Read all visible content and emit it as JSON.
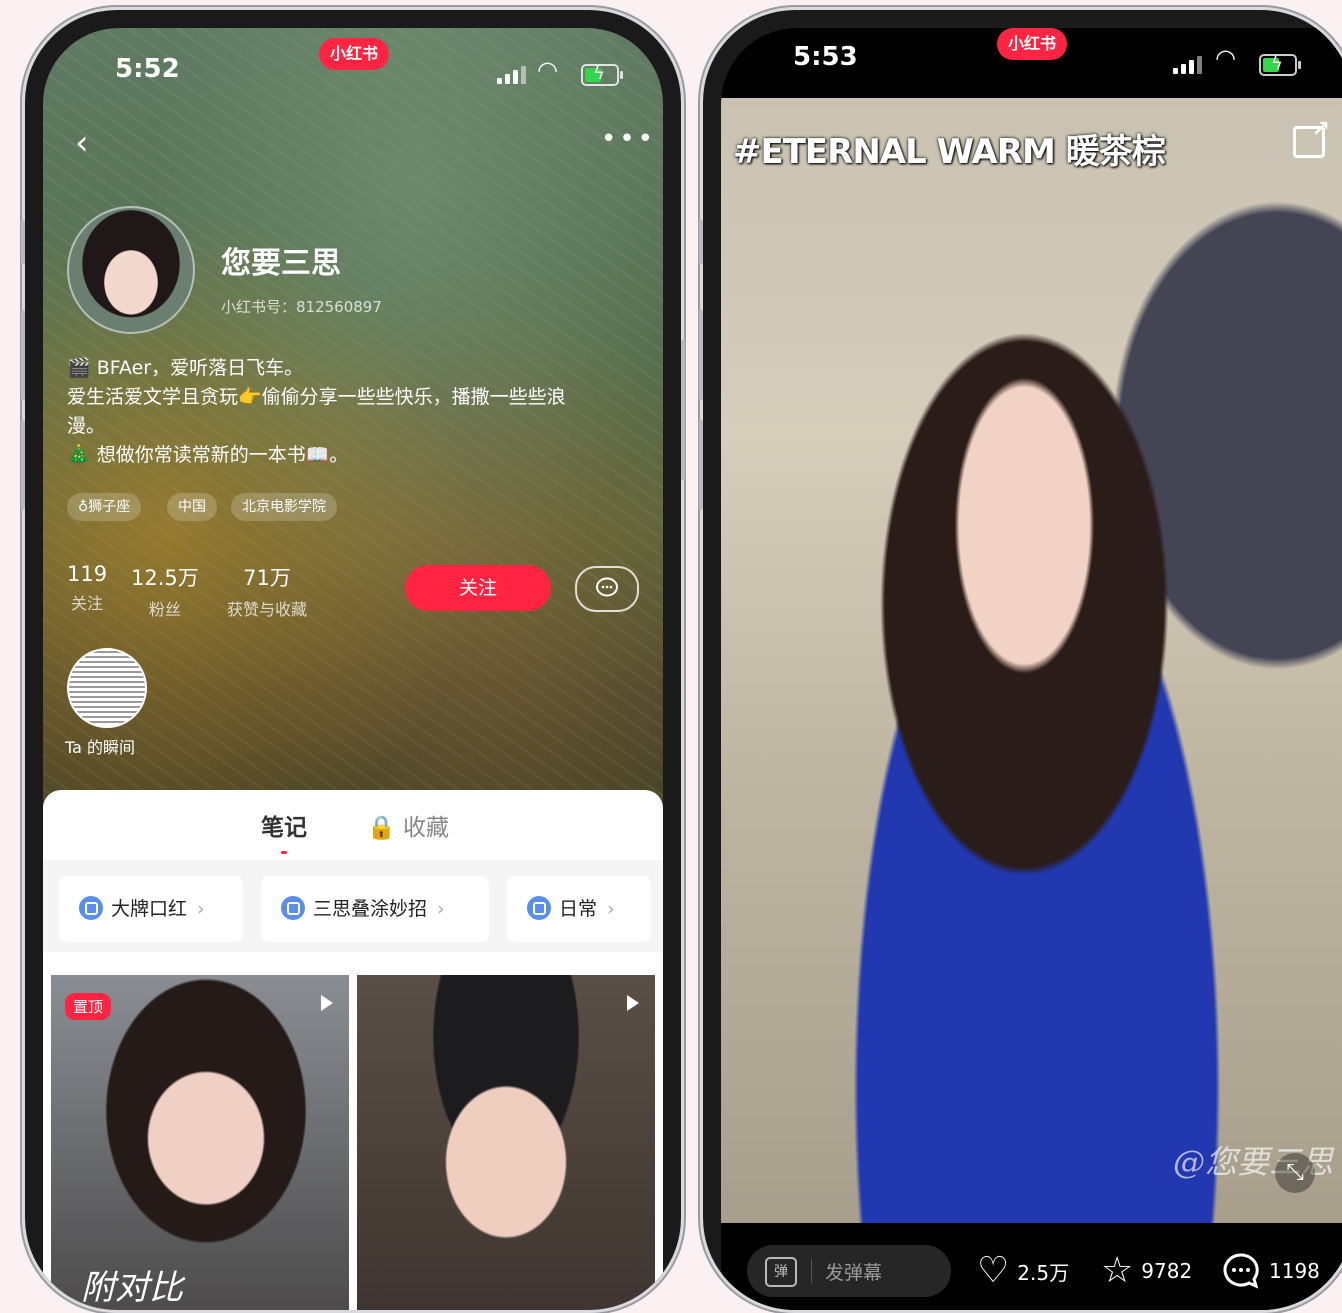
{
  "left": {
    "status": {
      "time": "5:52",
      "app_badge": "小红书"
    },
    "profile": {
      "name": "您要三思",
      "red_id": "小红书号：812560897",
      "bio_lines": [
        "🎬 BFAer，爱听落日飞车。",
        "爱生活爱文学且贪玩👉偷偷分享一些些快乐，播撒一些些浪",
        "漫。",
        "🎄 想做你常读常新的一本书📖。"
      ],
      "tags": [
        "♁狮子座",
        "中国",
        "北京电影学院"
      ],
      "stats": [
        {
          "num": "119",
          "label": "关注"
        },
        {
          "num": "12.5万",
          "label": "粉丝"
        },
        {
          "num": "71万",
          "label": "获赞与收藏"
        }
      ],
      "follow_label": "关注",
      "moment_label": "Ta 的瞬间"
    },
    "tabs": {
      "notes": "笔记",
      "favorites": "🔒 收藏"
    },
    "collections": [
      "大牌口红",
      "三思叠涂妙招",
      "日常"
    ],
    "posts": [
      {
        "badge": "置顶",
        "overlay_text": "附对比"
      },
      {
        "badge": "",
        "overlay_text": ""
      }
    ]
  },
  "right": {
    "status": {
      "time": "5:53",
      "app_badge": "小红书"
    },
    "video": {
      "hashtag": "#ETERNAL WARM 暖茶棕",
      "watermark": "@您要三思"
    },
    "bottom": {
      "danmu_icon": "弹",
      "danmu_placeholder": "发弹幕",
      "likes": "2.5万",
      "collects": "9782",
      "comments": "1198"
    }
  },
  "colors": {
    "accent": "#ff2442",
    "battery": "#32d74b",
    "chip_icon": "#5b8def"
  }
}
